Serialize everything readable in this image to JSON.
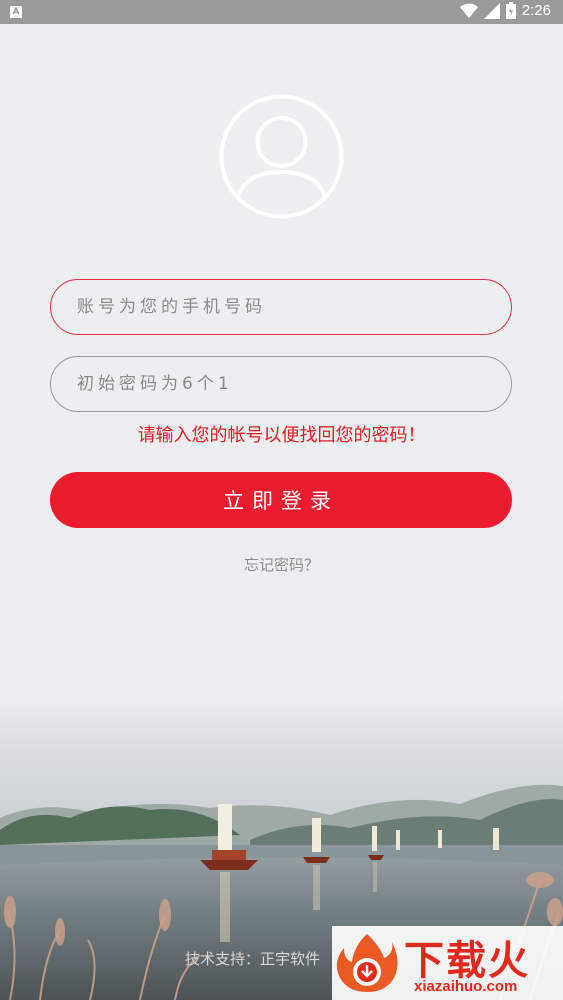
{
  "status_bar": {
    "time": "2:26",
    "app_icon_letter": "A",
    "icons": [
      "wifi-icon",
      "signal-icon",
      "battery-icon"
    ]
  },
  "avatar": {
    "icon": "user-icon"
  },
  "form": {
    "account_placeholder": "账号为您的手机号码",
    "password_placeholder": "初始密码为6个1",
    "hint": "请输入您的帐号以便找回您的密码！",
    "login_label": "立即登录",
    "forgot_label": "忘记密码？"
  },
  "footer": {
    "text": "技术支持：正宇软件"
  },
  "watermark": {
    "text": "下载火",
    "url": "xiazaihuo.com"
  },
  "colors": {
    "accent": "#ec1c2f",
    "hint": "#e41b23",
    "background": "#eceef0"
  }
}
